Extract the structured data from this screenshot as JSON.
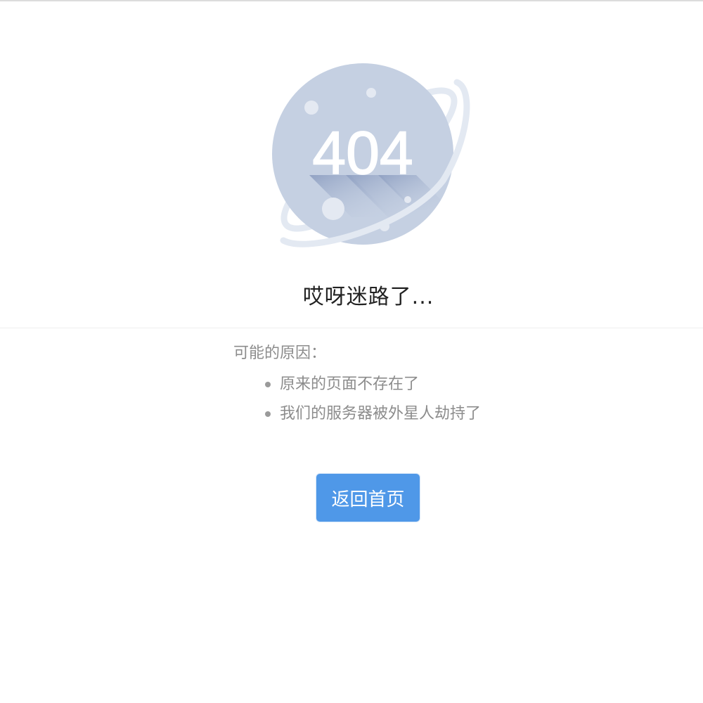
{
  "illustration": {
    "code_text": "404",
    "planet_color": "#c5d0e2",
    "ring_color": "#e3e9f2",
    "text_color": "#ffffff",
    "shadow_color": "#96a7c7"
  },
  "headline": "哎呀迷路了...",
  "reasons": {
    "title": "可能的原因：",
    "items": [
      "原来的页面不存在了",
      "我们的服务器被外星人劫持了"
    ]
  },
  "actions": {
    "home_label": "返回首页",
    "home_color": "#4f98e8"
  }
}
